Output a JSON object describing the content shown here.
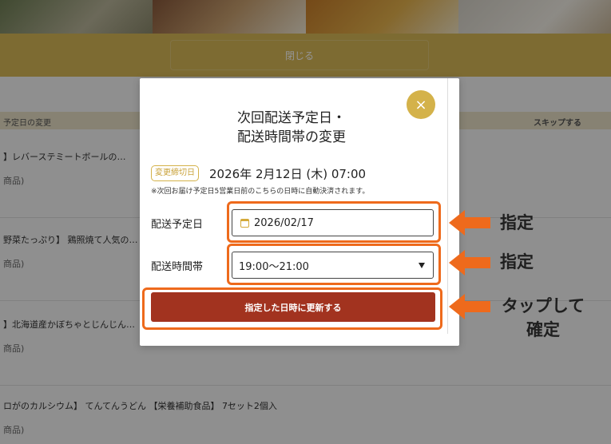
{
  "background": {
    "close_label": "閉じる",
    "list_header_left": "予定日の変更",
    "list_header_right": "スキップする",
    "rows": [
      {
        "title": "】レバーステミートボールの…",
        "sub": "商品)"
      },
      {
        "title": "野菜たっぷり】 鶏照焼て人気の…",
        "sub": "商品)"
      },
      {
        "title": "】北海道産かぼちゃとじんじん…",
        "sub": "商品)"
      },
      {
        "title": "ロがのカルシウム】 てんてんうどん 【栄養補助食品】 7セット2個入",
        "sub": "商品)"
      }
    ]
  },
  "modal": {
    "close_symbol": "×",
    "title_line1": "次回配送予定日・",
    "title_line2": "配送時間帯の変更",
    "deadline_badge": "変更締切日",
    "deadline_datetime": "2026年 2月12日 (木) 07:00",
    "deadline_note": "※次回お届け予定日5営業日前のこちらの日時に自動決済されます。",
    "delivery_date_label": "配送予定日",
    "delivery_date_value": "2026/02/17",
    "delivery_time_label": "配送時間帯",
    "delivery_time_value": "19:00〜21:00",
    "submit_label": "指定した日時に更新する"
  },
  "annotations": {
    "label_date": "指定",
    "label_time": "指定",
    "label_submit_line1": "タップして",
    "label_submit_line2": "確定",
    "color": "#ee6a1c"
  },
  "colors": {
    "accent_gold": "#d4b24a",
    "submit_red": "#a2331f",
    "annotation_orange": "#ee6a1c"
  },
  "icons": [
    "close-icon",
    "calendar-icon",
    "dropdown-arrow-icon",
    "arrow-left-icon"
  ]
}
